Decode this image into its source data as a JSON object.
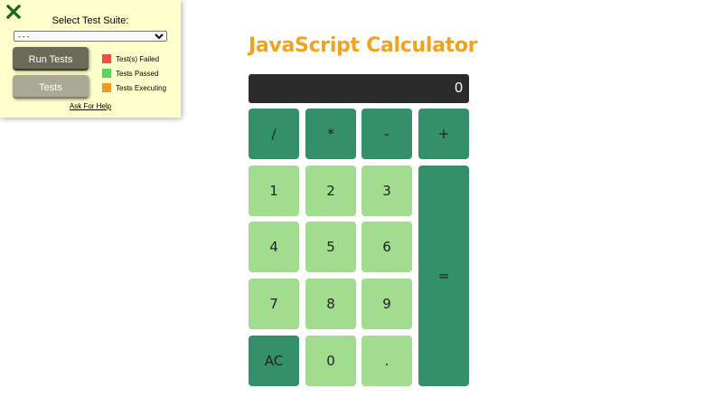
{
  "test_panel": {
    "select_label": "Select Test Suite:",
    "select_value": "- - -",
    "run_tests_label": "Run Tests",
    "tests_label": "Tests",
    "legend": [
      {
        "label": "Test(s) Failed",
        "color": "#f04e3e"
      },
      {
        "label": "Tests Passed",
        "color": "#5fd35a"
      },
      {
        "label": "Tests Executing",
        "color": "#f39a1c"
      }
    ],
    "help_link": "Ask For Help",
    "close_icon": "close-x-icon",
    "close_color": "#156a12"
  },
  "calculator": {
    "title": "JavaScript Calculator",
    "display": "0",
    "colors": {
      "title": "#f0a31b",
      "display_bg": "#2b2b2b",
      "key_dark": "#34906a",
      "key_light": "#a2dc8e"
    },
    "keys": {
      "divide": "/",
      "multiply": "*",
      "subtract": "-",
      "add": "+",
      "one": "1",
      "two": "2",
      "three": "3",
      "four": "4",
      "five": "5",
      "six": "6",
      "seven": "7",
      "eight": "8",
      "nine": "9",
      "clear": "AC",
      "zero": "0",
      "decimal": ".",
      "equals": "="
    }
  }
}
